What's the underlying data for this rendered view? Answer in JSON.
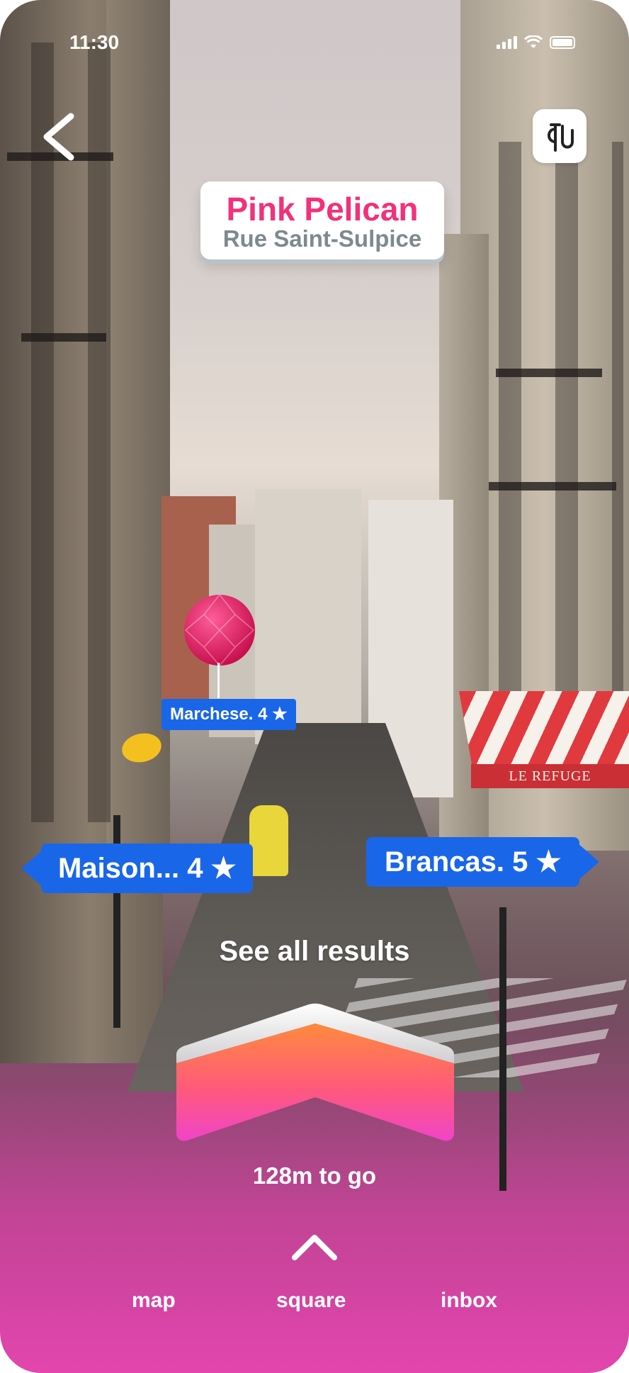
{
  "status_bar": {
    "time": "11:30",
    "icons": [
      "signal-icon",
      "wifi-icon",
      "battery-icon"
    ]
  },
  "header": {
    "back_icon": "chevron-left-icon",
    "profile_icon": "logo-icon"
  },
  "destination": {
    "name": "Pink Pelican",
    "street": "Rue Saint-Sulpice",
    "name_color": "#f2317a",
    "street_color": "#7d8a8e"
  },
  "markers": [
    {
      "label": "Marchese. 4 ★",
      "style": "small"
    },
    {
      "label": "Maison... 4 ★",
      "style": "large-left"
    },
    {
      "label": "Brancas. 5 ★",
      "style": "large-right"
    }
  ],
  "scene": {
    "awning_text": "LE REFUGE"
  },
  "navigation": {
    "see_all": "See all results",
    "distance": "128m to go",
    "accent_color": "#1a66e8"
  },
  "bottom_nav": {
    "map": "map",
    "square": "square",
    "inbox": "inbox"
  }
}
